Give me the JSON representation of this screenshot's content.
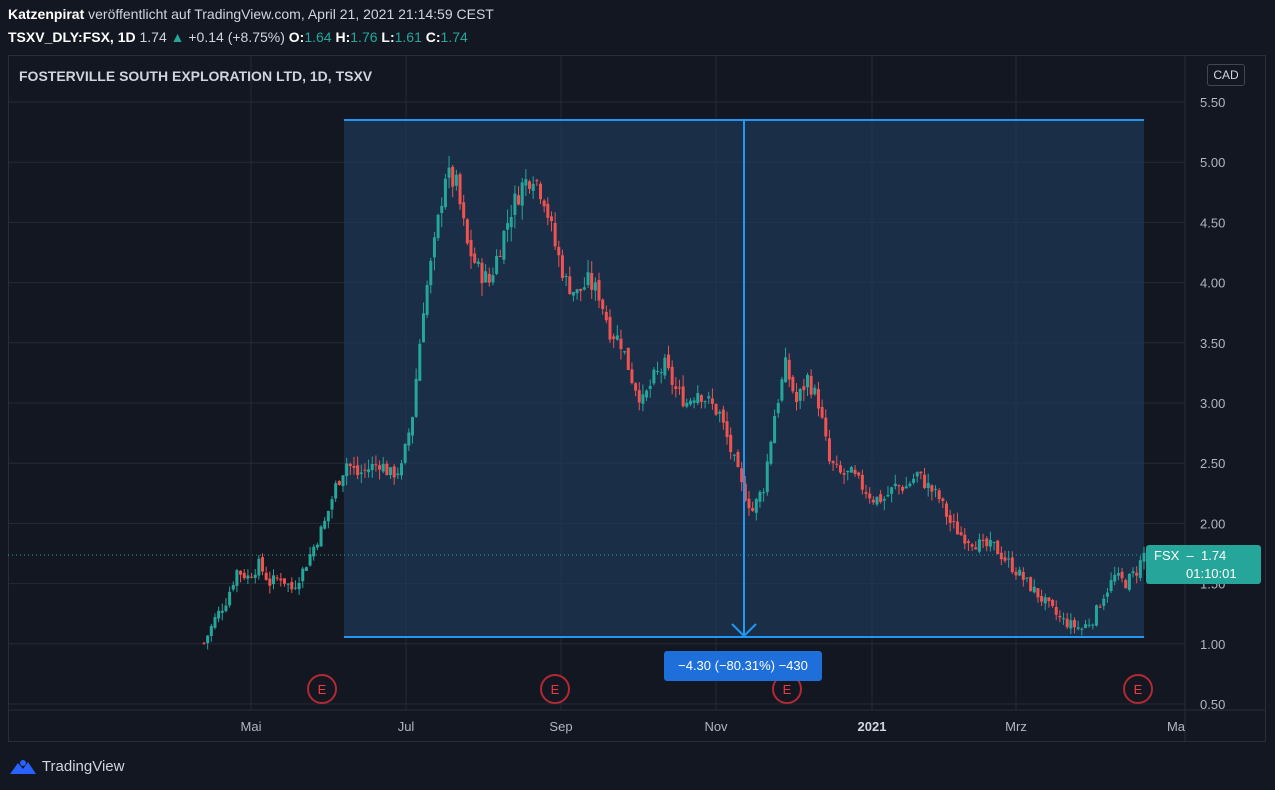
{
  "header": {
    "author": "Katzenpirat",
    "published_text": "veröffentlicht auf TradingView.com, April 21, 2021 21:14:59 CEST",
    "symbol": "TSXV_DLY:FSX, 1D",
    "last": "1.74",
    "change": "+0.14 (+8.75%)",
    "o_label": "O:",
    "o": "1.64",
    "h_label": "H:",
    "h": "1.76",
    "l_label": "L:",
    "l": "1.61",
    "c_label": "C:",
    "c": "1.74"
  },
  "chart_title": "FOSTERVILLE SOUTH EXPLORATION LTD, 1D, TSXV",
  "currency_button": "CAD",
  "measure_label": "−4.30 (−80.31%) −430",
  "price_tag": {
    "symbol": "FSX",
    "price": "1.74",
    "countdown": "01:10:01"
  },
  "logo_text": "TradingView",
  "colors": {
    "background": "#131722",
    "up": "#26a69a",
    "down": "#ef5350",
    "measure": "#2196f3",
    "earnings": "#f23645"
  },
  "chart_data": {
    "type": "candlestick",
    "title": "FOSTERVILLE SOUTH EXPLORATION LTD, 1D, TSXV",
    "y_ticks": [
      "5.50",
      "5.00",
      "4.50",
      "4.00",
      "3.50",
      "3.00",
      "2.50",
      "2.00",
      "1.50",
      "1.00",
      "0.50"
    ],
    "x_ticks": [
      {
        "label": "Mai",
        "bold": false
      },
      {
        "label": "Jul",
        "bold": false
      },
      {
        "label": "Sep",
        "bold": false
      },
      {
        "label": "Nov",
        "bold": false
      },
      {
        "label": "2021",
        "bold": true
      },
      {
        "label": "Mrz",
        "bold": false
      },
      {
        "label": "Ma",
        "bold": false
      }
    ],
    "ylim": [
      0.5,
      5.5
    ],
    "grid": true,
    "earnings_markers": [
      "E",
      "E",
      "E",
      "E"
    ],
    "measure": {
      "high": 5.35,
      "low": 1.05,
      "change": -4.3,
      "percent": -80.31
    },
    "close_path": [
      [
        0,
        1.0
      ],
      [
        3,
        1.2
      ],
      [
        6,
        1.35
      ],
      [
        9,
        1.6
      ],
      [
        12,
        1.55
      ],
      [
        15,
        1.65
      ],
      [
        18,
        1.5
      ],
      [
        21,
        1.55
      ],
      [
        24,
        1.45
      ],
      [
        27,
        1.6
      ],
      [
        30,
        1.8
      ],
      [
        33,
        2.0
      ],
      [
        36,
        2.3
      ],
      [
        39,
        2.5
      ],
      [
        42,
        2.4
      ],
      [
        45,
        2.45
      ],
      [
        48,
        2.5
      ],
      [
        51,
        2.4
      ],
      [
        54,
        2.45
      ],
      [
        57,
        2.9
      ],
      [
        60,
        3.8
      ],
      [
        63,
        4.3
      ],
      [
        66,
        4.9
      ],
      [
        69,
        4.8
      ],
      [
        72,
        4.3
      ],
      [
        75,
        4.1
      ],
      [
        78,
        4.0
      ],
      [
        81,
        4.3
      ],
      [
        84,
        4.6
      ],
      [
        87,
        4.8
      ],
      [
        90,
        4.9
      ],
      [
        93,
        4.7
      ],
      [
        96,
        4.3
      ],
      [
        99,
        4.0
      ],
      [
        102,
        3.9
      ],
      [
        105,
        4.0
      ],
      [
        108,
        3.9
      ],
      [
        111,
        3.6
      ],
      [
        114,
        3.5
      ],
      [
        117,
        3.2
      ],
      [
        120,
        3.0
      ],
      [
        123,
        3.2
      ],
      [
        126,
        3.3
      ],
      [
        129,
        3.1
      ],
      [
        132,
        3.0
      ],
      [
        135,
        3.1
      ],
      [
        138,
        3.0
      ],
      [
        141,
        2.9
      ],
      [
        144,
        2.6
      ],
      [
        147,
        2.3
      ],
      [
        150,
        2.1
      ],
      [
        153,
        2.3
      ],
      [
        156,
        2.9
      ],
      [
        159,
        3.3
      ],
      [
        162,
        3.0
      ],
      [
        165,
        3.2
      ],
      [
        168,
        3.0
      ],
      [
        171,
        2.5
      ],
      [
        174,
        2.4
      ],
      [
        177,
        2.4
      ],
      [
        180,
        2.3
      ],
      [
        183,
        2.2
      ],
      [
        186,
        2.2
      ],
      [
        189,
        2.3
      ],
      [
        192,
        2.3
      ],
      [
        195,
        2.4
      ],
      [
        198,
        2.3
      ],
      [
        201,
        2.2
      ],
      [
        204,
        2.0
      ],
      [
        207,
        1.9
      ],
      [
        210,
        1.85
      ],
      [
        213,
        1.8
      ],
      [
        216,
        1.8
      ],
      [
        219,
        1.7
      ],
      [
        222,
        1.6
      ],
      [
        225,
        1.5
      ],
      [
        228,
        1.4
      ],
      [
        231,
        1.3
      ],
      [
        234,
        1.2
      ],
      [
        237,
        1.15
      ],
      [
        240,
        1.12
      ],
      [
        243,
        1.2
      ],
      [
        246,
        1.4
      ],
      [
        249,
        1.55
      ],
      [
        252,
        1.5
      ],
      [
        255,
        1.6
      ],
      [
        257,
        1.74
      ]
    ]
  }
}
